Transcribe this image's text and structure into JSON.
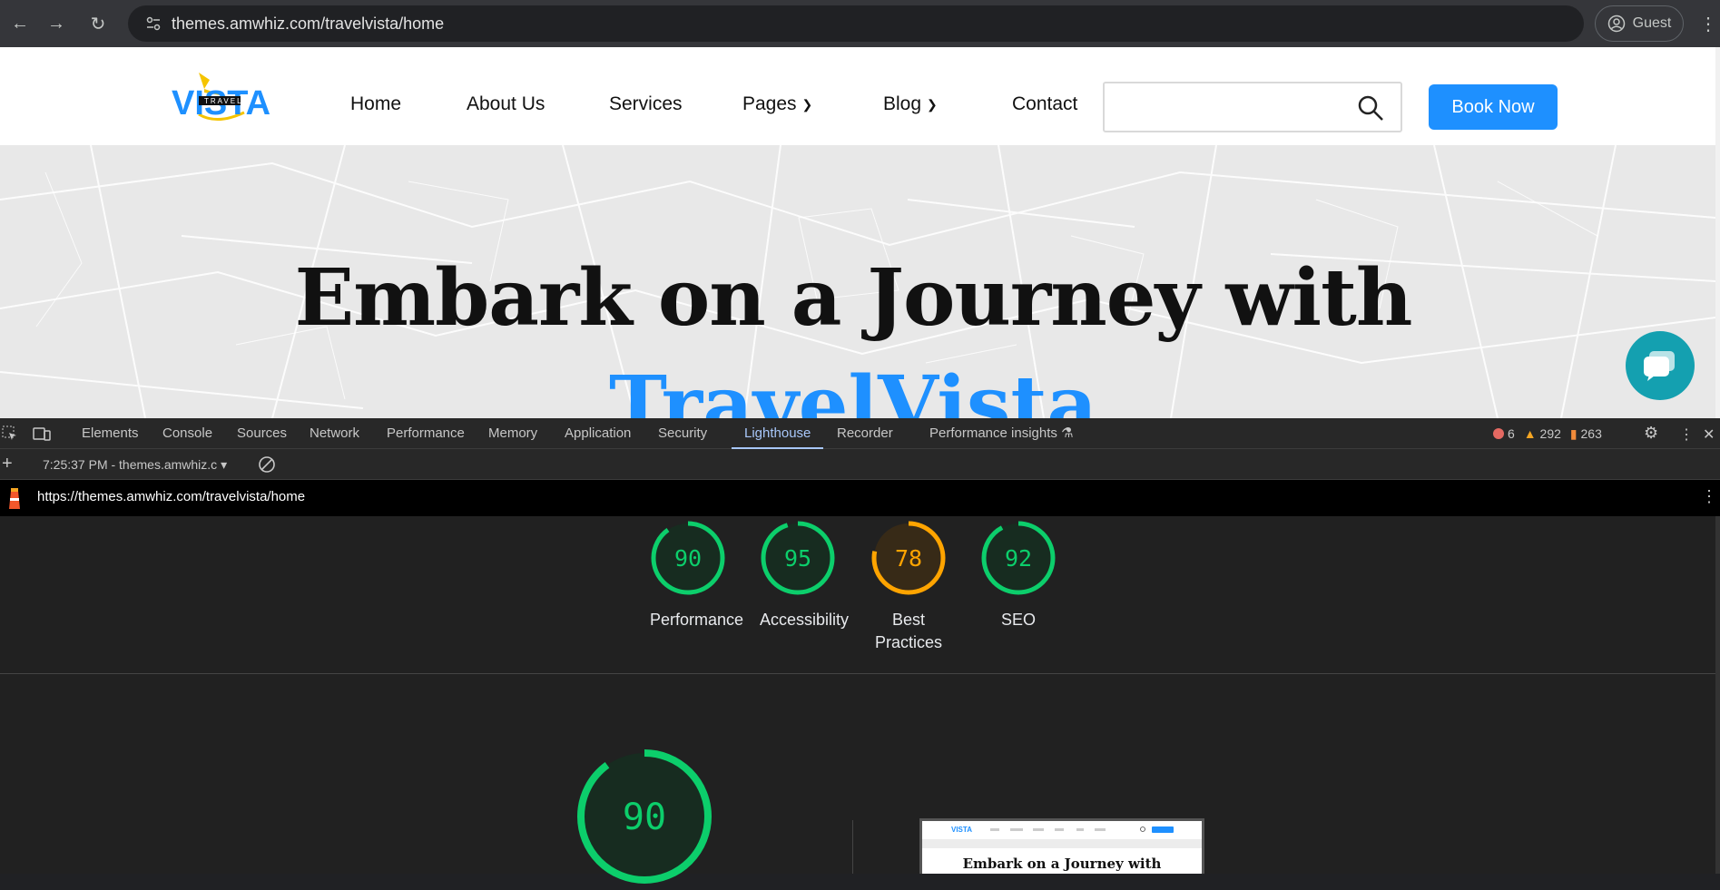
{
  "browser": {
    "url_host": "themes.amwhiz.com",
    "url_path": "/travelvista/home",
    "profile_label": "Guest"
  },
  "site": {
    "logo_text": "VISTA",
    "logo_sub": "TRAVEL",
    "nav": [
      {
        "label": "Home"
      },
      {
        "label": "About Us"
      },
      {
        "label": "Services"
      },
      {
        "label": "Pages",
        "has_dropdown": true
      },
      {
        "label": "Blog",
        "has_dropdown": true
      },
      {
        "label": "Contact"
      }
    ],
    "search_placeholder": "",
    "book_now": "Book Now",
    "hero_title": "Embark on a Journey with",
    "hero_brand": "TravelVista",
    "colors": {
      "brand": "#1e90ff",
      "chat": "#14a0b0"
    }
  },
  "devtools": {
    "tabs": [
      "Elements",
      "Console",
      "Sources",
      "Network",
      "Performance",
      "Memory",
      "Application",
      "Security",
      "Lighthouse",
      "Recorder",
      "Performance insights"
    ],
    "active_tab": "Lighthouse",
    "issues": {
      "errors": "6",
      "warnings": "292",
      "info": "263"
    },
    "report_select": "7:25:37 PM - themes.amwhiz.c",
    "report_url": "https://themes.amwhiz.com/travelvista/home"
  },
  "lighthouse": {
    "scores": [
      {
        "label": "Performance",
        "score": "90",
        "value": 90,
        "color": "#0cce6b"
      },
      {
        "label": "Accessibility",
        "score": "95",
        "value": 95,
        "color": "#0cce6b"
      },
      {
        "label": "Best Practices",
        "score": "78",
        "value": 78,
        "color": "#ffa400"
      },
      {
        "label": "SEO",
        "score": "92",
        "value": 92,
        "color": "#0cce6b"
      }
    ],
    "main_score": "90",
    "main_value": 90,
    "thumbnail_title": "Embark on a Journey with"
  }
}
